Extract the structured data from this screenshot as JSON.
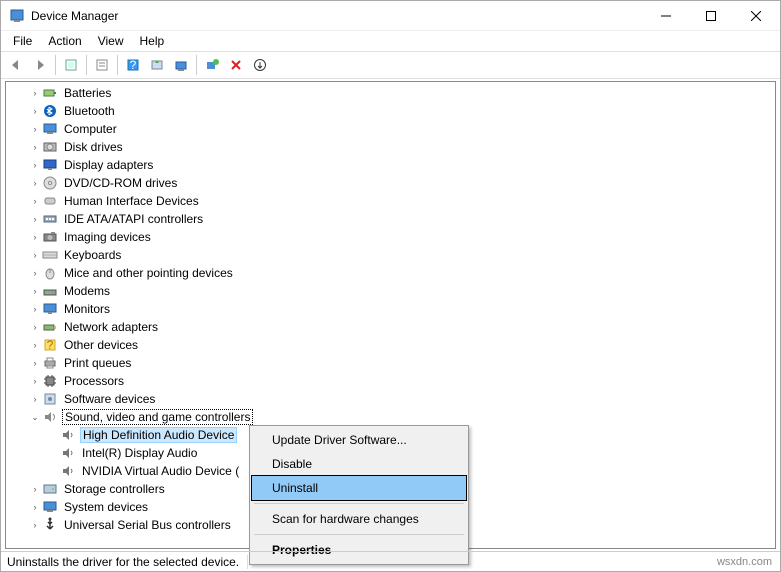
{
  "window": {
    "title": "Device Manager"
  },
  "menubar": [
    "File",
    "Action",
    "View",
    "Help"
  ],
  "toolbar_icons": [
    "back",
    "forward",
    "sep",
    "show-hidden",
    "properties",
    "sep",
    "help",
    "update",
    "monitor",
    "sep",
    "scan",
    "delete",
    "enable"
  ],
  "tree": [
    {
      "level": 1,
      "expanded": false,
      "icon": "battery-icon",
      "label": "Batteries"
    },
    {
      "level": 1,
      "expanded": false,
      "icon": "bluetooth-icon",
      "label": "Bluetooth"
    },
    {
      "level": 1,
      "expanded": false,
      "icon": "computer-icon",
      "label": "Computer"
    },
    {
      "level": 1,
      "expanded": false,
      "icon": "disk-icon",
      "label": "Disk drives"
    },
    {
      "level": 1,
      "expanded": false,
      "icon": "display-icon",
      "label": "Display adapters"
    },
    {
      "level": 1,
      "expanded": false,
      "icon": "dvd-icon",
      "label": "DVD/CD-ROM drives"
    },
    {
      "level": 1,
      "expanded": false,
      "icon": "hid-icon",
      "label": "Human Interface Devices"
    },
    {
      "level": 1,
      "expanded": false,
      "icon": "ide-icon",
      "label": "IDE ATA/ATAPI controllers"
    },
    {
      "level": 1,
      "expanded": false,
      "icon": "camera-icon",
      "label": "Imaging devices"
    },
    {
      "level": 1,
      "expanded": false,
      "icon": "keyboard-icon",
      "label": "Keyboards"
    },
    {
      "level": 1,
      "expanded": false,
      "icon": "mouse-icon",
      "label": "Mice and other pointing devices"
    },
    {
      "level": 1,
      "expanded": false,
      "icon": "modem-icon",
      "label": "Modems"
    },
    {
      "level": 1,
      "expanded": false,
      "icon": "monitor-icon",
      "label": "Monitors"
    },
    {
      "level": 1,
      "expanded": false,
      "icon": "netadapter-icon",
      "label": "Network adapters"
    },
    {
      "level": 1,
      "expanded": false,
      "icon": "other-icon",
      "label": "Other devices"
    },
    {
      "level": 1,
      "expanded": false,
      "icon": "printer-icon",
      "label": "Print queues"
    },
    {
      "level": 1,
      "expanded": false,
      "icon": "cpu-icon",
      "label": "Processors"
    },
    {
      "level": 1,
      "expanded": false,
      "icon": "software-icon",
      "label": "Software devices"
    },
    {
      "level": 1,
      "expanded": true,
      "icon": "sound-icon",
      "label": "Sound, video and game controllers",
      "boxed": true
    },
    {
      "level": 2,
      "expanded": null,
      "icon": "speaker-icon",
      "label": "High Definition Audio Device",
      "selected": true
    },
    {
      "level": 2,
      "expanded": null,
      "icon": "speaker-icon",
      "label": "Intel(R) Display Audio"
    },
    {
      "level": 2,
      "expanded": null,
      "icon": "speaker-icon",
      "label": "NVIDIA Virtual Audio Device ("
    },
    {
      "level": 1,
      "expanded": false,
      "icon": "storage-icon",
      "label": "Storage controllers"
    },
    {
      "level": 1,
      "expanded": false,
      "icon": "system-icon",
      "label": "System devices"
    },
    {
      "level": 1,
      "expanded": false,
      "icon": "usb-icon",
      "label": "Universal Serial Bus controllers"
    }
  ],
  "context_menu": [
    {
      "label": "Update Driver Software...",
      "type": "item"
    },
    {
      "label": "Disable",
      "type": "item"
    },
    {
      "label": "Uninstall",
      "type": "item",
      "highlight": true
    },
    {
      "type": "sep"
    },
    {
      "label": "Scan for hardware changes",
      "type": "item"
    },
    {
      "type": "sep"
    },
    {
      "label": "Properties",
      "type": "item",
      "bold": true
    }
  ],
  "status": {
    "text": "Uninstalls the driver for the selected device."
  },
  "watermark": "wsxdn.com"
}
